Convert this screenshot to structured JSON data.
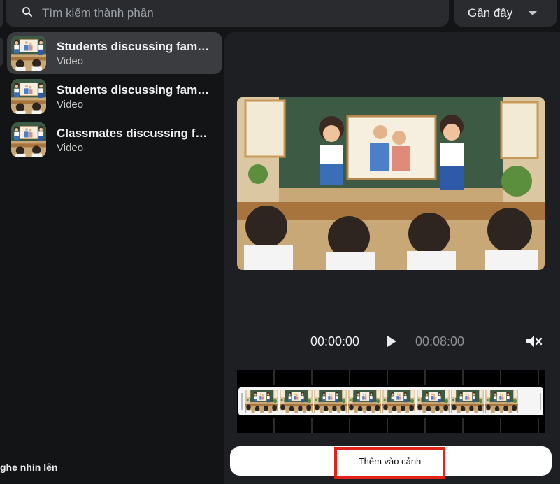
{
  "search": {
    "placeholder": "Tìm kiếm thành phần",
    "icon": "search-icon"
  },
  "sort": {
    "label": "Gần đây",
    "icon": "caret-down-icon"
  },
  "items": [
    {
      "title": "Students discussing family in class",
      "type": "Video",
      "selected": true
    },
    {
      "title": "Students discussing family in class",
      "type": "Video",
      "selected": false
    },
    {
      "title": "Classmates discussing family",
      "type": "Video",
      "selected": false
    }
  ],
  "bottom_left_text": "ghe nhìn lên",
  "player": {
    "current_time": "00:00:00",
    "total_time": "00:08:00",
    "muted": true
  },
  "add_button": {
    "label": "Thêm vào cảnh"
  },
  "colors": {
    "background": "#131416",
    "panel": "#1e1f22",
    "selected_item": "#3b3c3f",
    "highlight_box": "#e2231a"
  }
}
